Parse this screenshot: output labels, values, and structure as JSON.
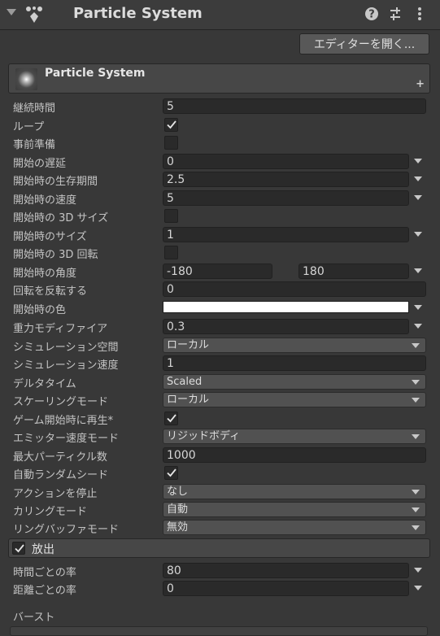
{
  "header": {
    "title": "Particle System"
  },
  "editor_button": {
    "label": "エディターを開く..."
  },
  "module": {
    "title": "Particle System",
    "plus": "+"
  },
  "props": {
    "duration": {
      "label": "継続時間",
      "value": "5"
    },
    "looping": {
      "label": "ループ",
      "checked": true
    },
    "prewarm": {
      "label": "事前準備",
      "checked": false
    },
    "start_delay": {
      "label": "開始の遅延",
      "value": "0"
    },
    "start_lifetime": {
      "label": "開始時の生存期間",
      "value": "2.5"
    },
    "start_speed": {
      "label": "開始時の速度",
      "value": "5"
    },
    "size_3d": {
      "label": "開始時の 3D サイズ",
      "checked": false
    },
    "start_size": {
      "label": "開始時のサイズ",
      "value": "1"
    },
    "rotation_3d": {
      "label": "開始時の 3D 回転",
      "checked": false
    },
    "start_rotation": {
      "label": "開始時の角度",
      "min": "-180",
      "max": "180"
    },
    "flip_rotation": {
      "label": "回転を反転する",
      "value": "0"
    },
    "start_color": {
      "label": "開始時の色",
      "color": "#ffffff"
    },
    "gravity": {
      "label": "重力モディファイア",
      "value": "0.3"
    },
    "sim_space": {
      "label": "シミュレーション空間",
      "value": "ローカル"
    },
    "sim_speed": {
      "label": "シミュレーション速度",
      "value": "1"
    },
    "delta_time": {
      "label": "デルタタイム",
      "value": "Scaled"
    },
    "scaling_mode": {
      "label": "スケーリングモード",
      "value": "ローカル"
    },
    "play_on_awake": {
      "label": "ゲーム開始時に再生*",
      "checked": true
    },
    "emitter_velocity": {
      "label": "エミッター速度モード",
      "value": "リジッドボディ"
    },
    "max_particles": {
      "label": "最大パーティクル数",
      "value": "1000"
    },
    "auto_seed": {
      "label": "自動ランダムシード",
      "checked": true
    },
    "stop_action": {
      "label": "アクションを停止",
      "value": "なし"
    },
    "culling_mode": {
      "label": "カリングモード",
      "value": "自動"
    },
    "ring_buffer": {
      "label": "リングバッファモード",
      "value": "無効"
    }
  },
  "emission": {
    "title": "放出",
    "enabled": true,
    "rate_over_time": {
      "label": "時間ごとの率",
      "value": "80"
    },
    "rate_over_distance": {
      "label": "距離ごとの率",
      "value": "0"
    },
    "bursts": {
      "label": "バースト"
    }
  },
  "icons": [
    "fold-arrow-icon",
    "particle-system-icon",
    "help-icon",
    "preset-icon",
    "kebab-menu-icon",
    "checkmark-icon",
    "chevron-down-icon"
  ],
  "colors": {
    "background": "#383838",
    "field": "#2a2a2a",
    "dropdown": "#515151",
    "header": "#474747"
  }
}
